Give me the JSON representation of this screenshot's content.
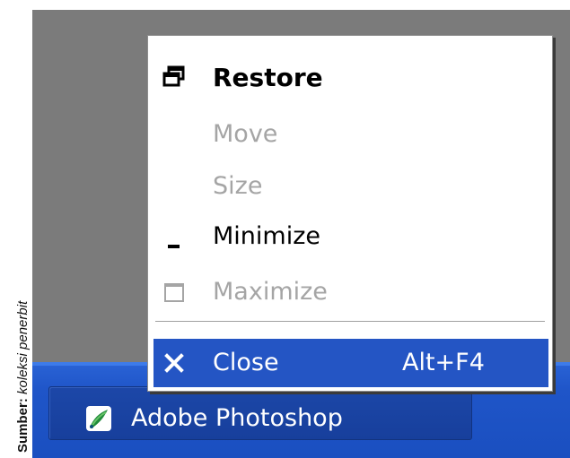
{
  "caption": {
    "label": "Sumber:",
    "source": "koleksi penerbit"
  },
  "menu": {
    "items": [
      {
        "label": "Restore",
        "icon": "restore-icon",
        "enabled": true
      },
      {
        "label": "Move",
        "enabled": false
      },
      {
        "label": "Size",
        "enabled": false
      },
      {
        "label": "Minimize",
        "icon": "minimize-icon",
        "enabled": true
      },
      {
        "label": "Maximize",
        "icon": "maximize-icon",
        "enabled": false
      },
      {
        "label": "Close",
        "icon": "close-icon",
        "shortcut": "Alt+F4",
        "enabled": true,
        "highlighted": true
      }
    ]
  },
  "taskbar": {
    "button_label": "Adobe Photoshop",
    "icon": "photoshop-app-icon"
  },
  "colors": {
    "desktop": "#7b7b7b",
    "taskbar": "#1f55c8",
    "highlight": "#2455c4",
    "disabled_text": "#a5a5a5"
  }
}
